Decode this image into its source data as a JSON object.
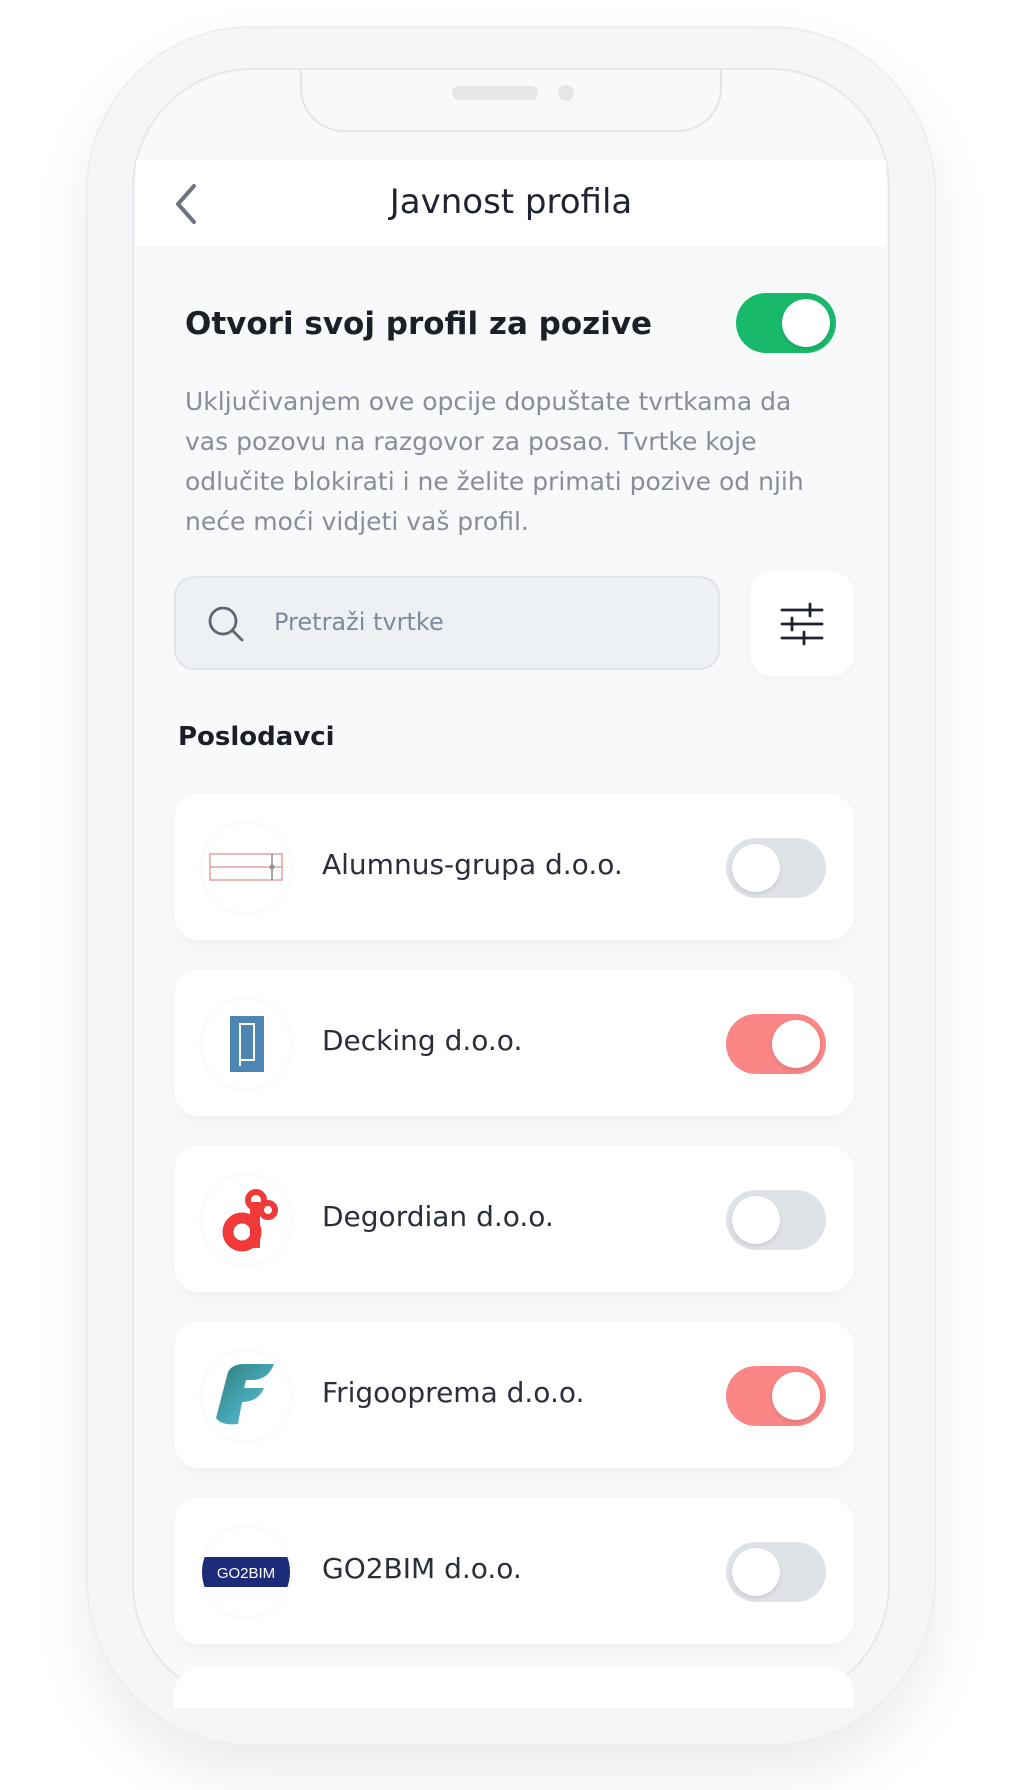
{
  "header": {
    "title": "Javnost profila"
  },
  "open_profile": {
    "label": "Otvori svoj profil za pozive",
    "enabled": true,
    "toggle_color": "#18b96a",
    "description": "Uključivanjem ove opcije dopuštate tvrtkama da vas pozovu na razgovor za posao. Tvrtke koje odlučite blokirati i ne želite primati pozive od njih neće moći vidjeti vaš profil."
  },
  "search": {
    "placeholder": "Pretraži tvrtke",
    "icon": "search-icon"
  },
  "filter": {
    "icon": "sliders-icon"
  },
  "employers": {
    "section_title": "Poslodavci",
    "items": [
      {
        "name": "Alumnus-grupa d.o.o.",
        "blocked": false,
        "logo": "alumnus-logo"
      },
      {
        "name": "Decking d.o.o.",
        "blocked": true,
        "logo": "decking-logo"
      },
      {
        "name": "Degordian d.o.o.",
        "blocked": false,
        "logo": "degordian-logo"
      },
      {
        "name": "Frigooprema d.o.o.",
        "blocked": true,
        "logo": "frigooprema-logo"
      },
      {
        "name": "GO2BIM d.o.o.",
        "blocked": false,
        "logo": "go2bim-logo",
        "logo_text": "GO2BIM"
      }
    ]
  },
  "colors": {
    "toggle_on_green": "#18b96a",
    "toggle_on_red": "#fa8686",
    "toggle_off": "#dfe3e8"
  }
}
